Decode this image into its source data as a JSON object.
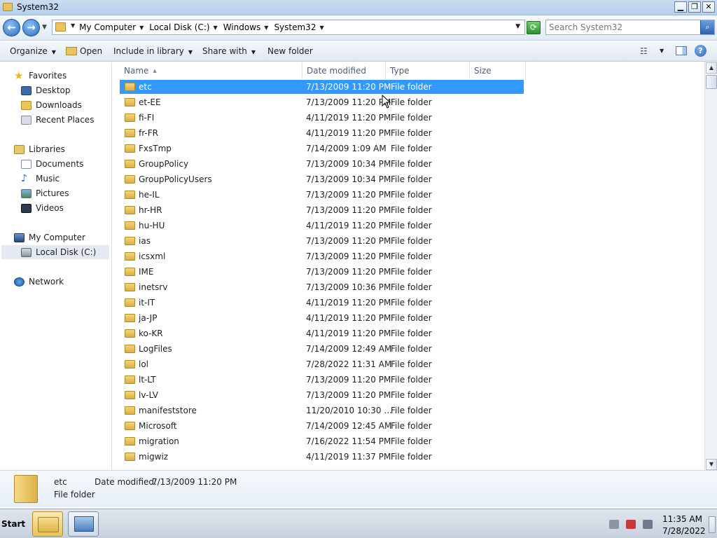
{
  "window": {
    "title": "System32"
  },
  "address": {
    "crumbs": [
      "My Computer",
      "Local Disk (C:)",
      "Windows",
      "System32"
    ]
  },
  "search": {
    "placeholder": "Search System32"
  },
  "commands": {
    "organize": "Organize",
    "open": "Open",
    "include": "Include in library",
    "share": "Share with",
    "new_folder": "New folder"
  },
  "nav": {
    "favorites": "Favorites",
    "desktop": "Desktop",
    "downloads": "Downloads",
    "recent": "Recent Places",
    "libraries": "Libraries",
    "documents": "Documents",
    "music": "Music",
    "pictures": "Pictures",
    "videos": "Videos",
    "computer": "My Computer",
    "local_disk": "Local Disk (C:)",
    "network": "Network"
  },
  "columns": {
    "name": "Name",
    "date": "Date modified",
    "type": "Type",
    "size": "Size"
  },
  "files": [
    {
      "name": "etc",
      "date": "7/13/2009 11:20 PM",
      "type": "File folder"
    },
    {
      "name": "et-EE",
      "date": "7/13/2009 11:20 PM",
      "type": "File folder"
    },
    {
      "name": "fi-FI",
      "date": "4/11/2019 11:20 PM",
      "type": "File folder"
    },
    {
      "name": "fr-FR",
      "date": "4/11/2019 11:20 PM",
      "type": "File folder"
    },
    {
      "name": "FxsTmp",
      "date": "7/14/2009 1:09 AM",
      "type": "File folder"
    },
    {
      "name": "GroupPolicy",
      "date": "7/13/2009 10:34 PM",
      "type": "File folder"
    },
    {
      "name": "GroupPolicyUsers",
      "date": "7/13/2009 10:34 PM",
      "type": "File folder"
    },
    {
      "name": "he-IL",
      "date": "7/13/2009 11:20 PM",
      "type": "File folder"
    },
    {
      "name": "hr-HR",
      "date": "7/13/2009 11:20 PM",
      "type": "File folder"
    },
    {
      "name": "hu-HU",
      "date": "4/11/2019 11:20 PM",
      "type": "File folder"
    },
    {
      "name": "ias",
      "date": "7/13/2009 11:20 PM",
      "type": "File folder"
    },
    {
      "name": "icsxml",
      "date": "7/13/2009 11:20 PM",
      "type": "File folder"
    },
    {
      "name": "IME",
      "date": "7/13/2009 11:20 PM",
      "type": "File folder"
    },
    {
      "name": "inetsrv",
      "date": "7/13/2009 10:36 PM",
      "type": "File folder"
    },
    {
      "name": "it-IT",
      "date": "4/11/2019 11:20 PM",
      "type": "File folder"
    },
    {
      "name": "ja-JP",
      "date": "4/11/2019 11:20 PM",
      "type": "File folder"
    },
    {
      "name": "ko-KR",
      "date": "4/11/2019 11:20 PM",
      "type": "File folder"
    },
    {
      "name": "LogFiles",
      "date": "7/14/2009 12:49 AM",
      "type": "File folder"
    },
    {
      "name": "lol",
      "date": "7/28/2022 11:31 AM",
      "type": "File folder"
    },
    {
      "name": "lt-LT",
      "date": "7/13/2009 11:20 PM",
      "type": "File folder"
    },
    {
      "name": "lv-LV",
      "date": "7/13/2009 11:20 PM",
      "type": "File folder"
    },
    {
      "name": "manifeststore",
      "date": "11/20/2010 10:30 ...",
      "type": "File folder"
    },
    {
      "name": "Microsoft",
      "date": "7/14/2009 12:45 AM",
      "type": "File folder"
    },
    {
      "name": "migration",
      "date": "7/16/2022 11:54 PM",
      "type": "File folder"
    },
    {
      "name": "migwiz",
      "date": "4/11/2019 11:37 PM",
      "type": "File folder"
    }
  ],
  "details": {
    "name": "etc",
    "date_label": "Date modified:",
    "date_value": "7/13/2009 11:20 PM",
    "type": "File folder"
  },
  "taskbar": {
    "start": "Start",
    "time": "11:35 AM",
    "date": "7/28/2022"
  },
  "icons": {
    "back": "back-arrow-icon",
    "forward": "forward-arrow-icon",
    "refresh": "refresh-icon",
    "search": "search-icon",
    "help": "help-icon",
    "folder": "folder-icon"
  },
  "colors": {
    "selection": "#3399ff",
    "title_bar": "#c9dcf2"
  }
}
